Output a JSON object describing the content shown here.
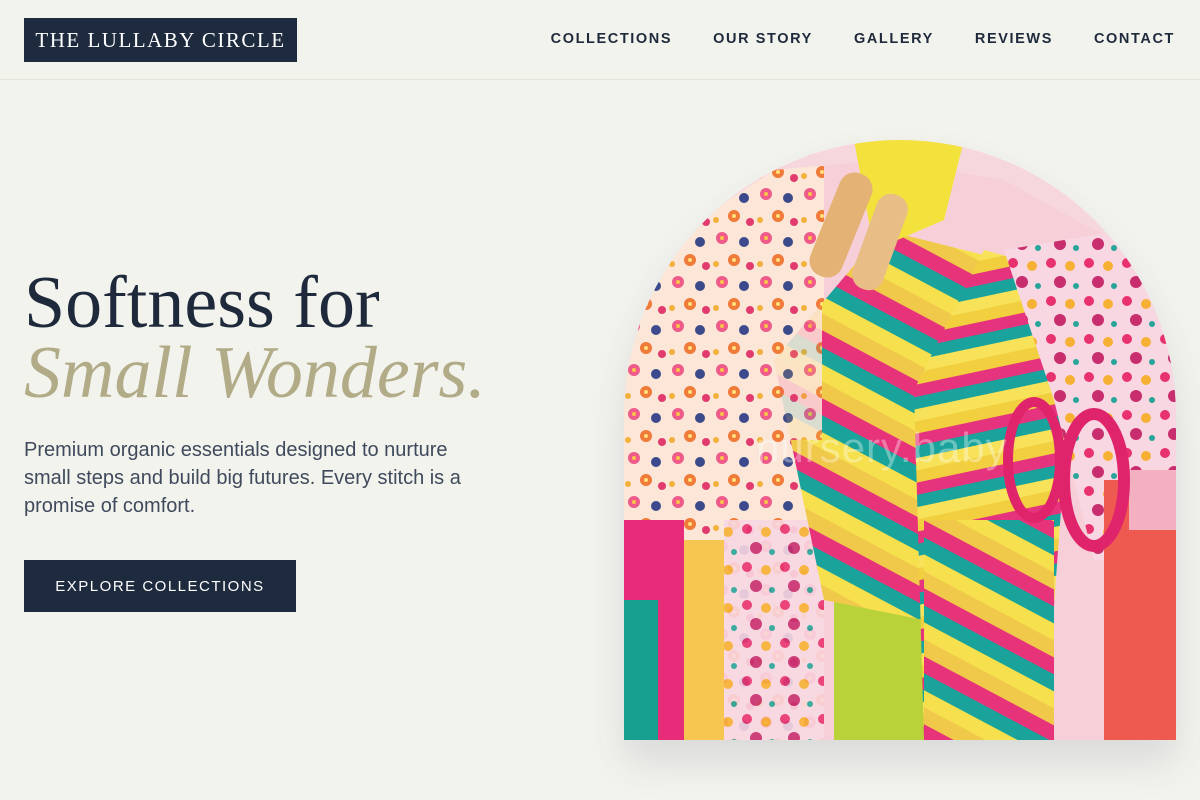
{
  "brand": {
    "name": "THE LULLABY CIRCLE"
  },
  "nav": {
    "items": [
      "COLLECTIONS",
      "OUR STORY",
      "GALLERY",
      "REVIEWS",
      "CONTACT"
    ]
  },
  "hero": {
    "title_line1": "Softness for",
    "title_line2": "Small Wonders.",
    "description": "Premium organic essentials designed to nurture small steps and build big futures. Every stitch is a promise of comfort.",
    "cta_label": "EXPLORE COLLECTIONS"
  },
  "image": {
    "watermark": "nursery.baby",
    "subject": "colorful striped and floral children's clothing on wooden hangers"
  },
  "colors": {
    "background": "#f3f3ee",
    "navy": "#1e2a3e",
    "accent": "#b1ab87"
  }
}
